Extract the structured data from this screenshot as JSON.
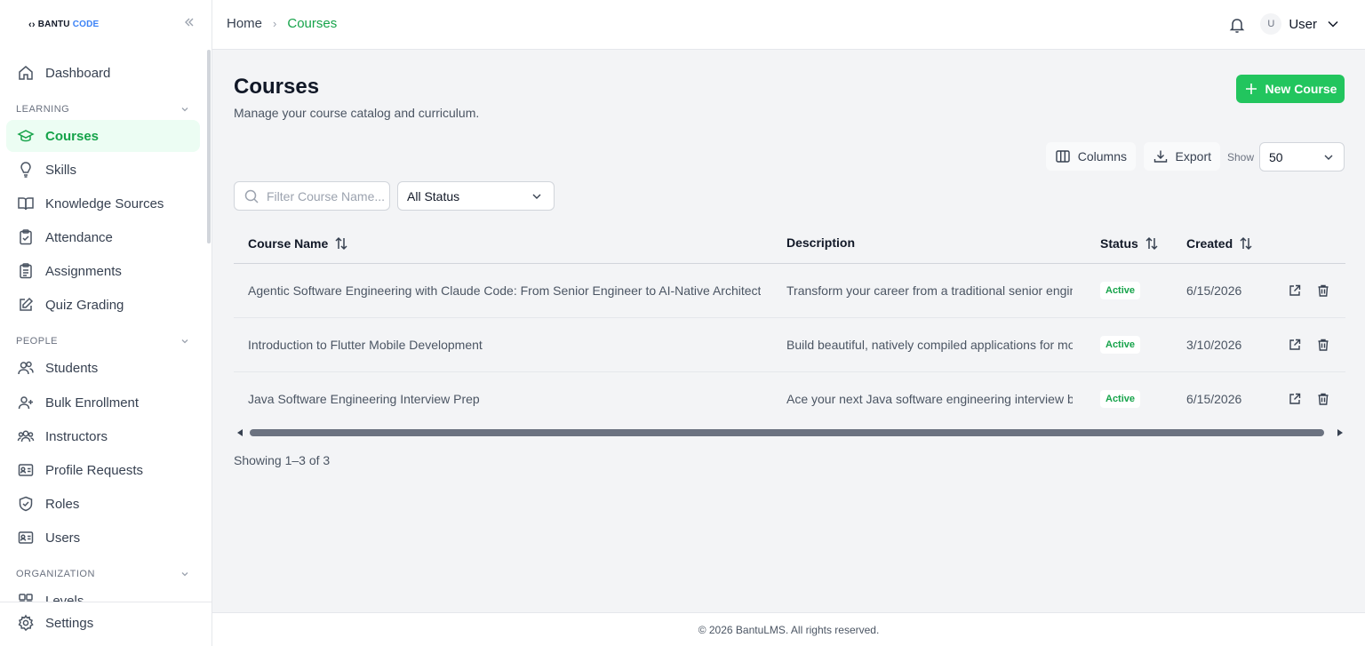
{
  "brand": {
    "name_part1": "BANTU",
    "name_part2": "CODE"
  },
  "sidebar": {
    "dashboard": "Dashboard",
    "learning_label": "LEARNING",
    "learning_items": [
      "Courses",
      "Skills",
      "Knowledge Sources",
      "Attendance",
      "Assignments",
      "Quiz Grading"
    ],
    "people_label": "PEOPLE",
    "people_items": [
      "Students",
      "Bulk Enrollment",
      "Instructors",
      "Profile Requests",
      "Roles",
      "Users"
    ],
    "organization_label": "ORGANIZATION",
    "organization_items": [
      "Levels"
    ],
    "settings": "Settings"
  },
  "header": {
    "breadcrumb_home": "Home",
    "breadcrumb_sep": "›",
    "breadcrumb_current": "Courses",
    "user_initial": "U",
    "user_name": "User"
  },
  "page": {
    "title": "Courses",
    "subtitle": "Manage your course catalog and curriculum.",
    "new_button": "New Course",
    "columns_button": "Columns",
    "export_button": "Export",
    "show_label": "Show",
    "show_value": "50",
    "filter_placeholder": "Filter Course Name...",
    "status_filter": "All Status"
  },
  "table": {
    "headers": {
      "name": "Course Name",
      "description": "Description",
      "status": "Status",
      "created": "Created"
    },
    "rows": [
      {
        "name": "Agentic Software Engineering with Claude Code: From Senior Engineer to AI-Native Architect",
        "description": "Transform your career from a traditional senior engineer",
        "status": "Active",
        "created": "6/15/2026"
      },
      {
        "name": "Introduction to Flutter Mobile Development",
        "description": "Build beautiful, natively compiled applications for mobile",
        "status": "Active",
        "created": "3/10/2026"
      },
      {
        "name": "Java Software Engineering Interview Prep",
        "description": "Ace your next Java software engineering interview by",
        "status": "Active",
        "created": "6/15/2026"
      }
    ]
  },
  "pagination": {
    "summary": "Showing 1–3 of 3"
  },
  "footer": {
    "copyright": "© 2026 BantuLMS. All rights reserved."
  },
  "colors": {
    "accent": "#22c55e",
    "accent_text": "#16a34a",
    "active_bg": "#ecfdf3"
  }
}
